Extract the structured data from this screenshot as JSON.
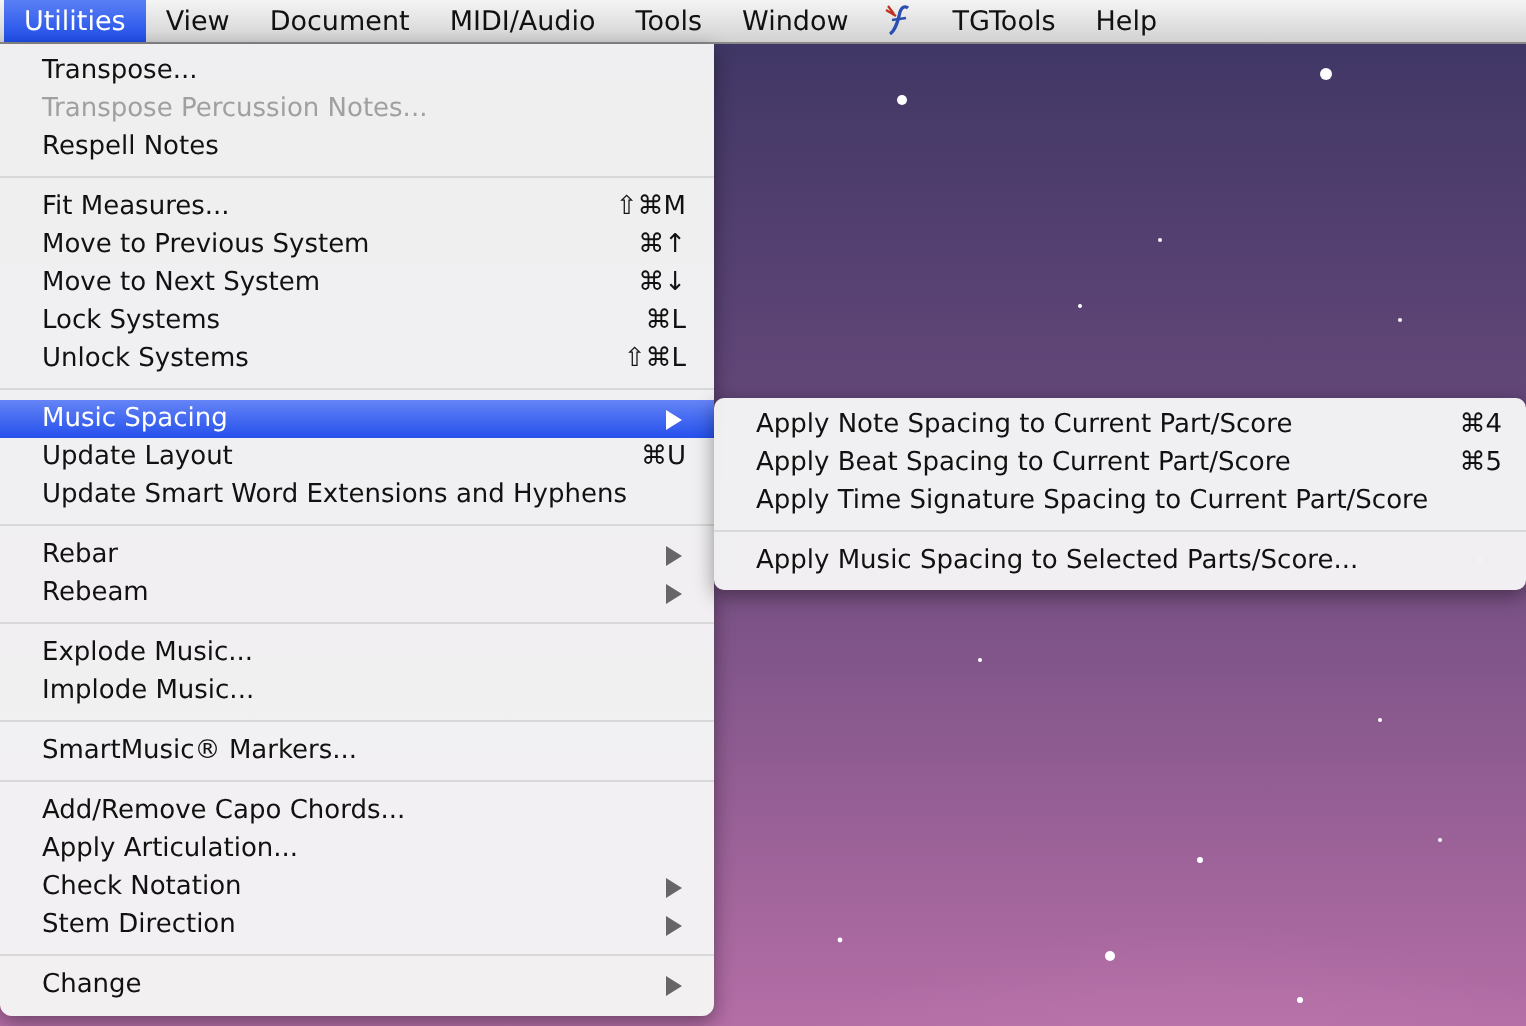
{
  "menu_bar": [
    {
      "kind": "text",
      "label": "Utilities",
      "selected": true
    },
    {
      "kind": "text",
      "label": "View",
      "selected": false
    },
    {
      "kind": "text",
      "label": "Document",
      "selected": false
    },
    {
      "kind": "text",
      "label": "MIDI/Audio",
      "selected": false
    },
    {
      "kind": "text",
      "label": "Tools",
      "selected": false
    },
    {
      "kind": "text",
      "label": "Window",
      "selected": false
    },
    {
      "kind": "icon",
      "selected": false
    },
    {
      "kind": "text",
      "label": "TGTools",
      "selected": false
    },
    {
      "kind": "text",
      "label": "Help",
      "selected": false
    }
  ],
  "menu": [
    {
      "kind": "item",
      "label": "Transpose...",
      "disabled": false,
      "selected": false
    },
    {
      "kind": "item",
      "label": "Transpose Percussion Notes...",
      "disabled": true,
      "selected": false
    },
    {
      "kind": "item",
      "label": "Respell Notes",
      "disabled": false,
      "selected": false
    },
    {
      "kind": "separator"
    },
    {
      "kind": "item",
      "label": "Fit Measures...",
      "shortcut": "⇧⌘M",
      "disabled": false,
      "selected": false
    },
    {
      "kind": "item",
      "label": "Move to Previous System",
      "shortcut": "⌘↑",
      "disabled": false,
      "selected": false
    },
    {
      "kind": "item",
      "label": "Move to Next System",
      "shortcut": "⌘↓",
      "disabled": false,
      "selected": false
    },
    {
      "kind": "item",
      "label": "Lock Systems",
      "shortcut": "⌘L",
      "disabled": false,
      "selected": false
    },
    {
      "kind": "item",
      "label": "Unlock Systems",
      "shortcut": "⇧⌘L",
      "disabled": false,
      "selected": false
    },
    {
      "kind": "separator"
    },
    {
      "kind": "item",
      "label": "Music Spacing",
      "submenu": true,
      "disabled": false,
      "selected": true
    },
    {
      "kind": "item",
      "label": "Update Layout",
      "shortcut": "⌘U",
      "disabled": false,
      "selected": false
    },
    {
      "kind": "item",
      "label": "Update Smart Word Extensions and Hyphens",
      "disabled": false,
      "selected": false
    },
    {
      "kind": "separator"
    },
    {
      "kind": "item",
      "label": "Rebar",
      "submenu": true,
      "disabled": false,
      "selected": false
    },
    {
      "kind": "item",
      "label": "Rebeam",
      "submenu": true,
      "disabled": false,
      "selected": false
    },
    {
      "kind": "separator"
    },
    {
      "kind": "item",
      "label": "Explode Music...",
      "disabled": false,
      "selected": false
    },
    {
      "kind": "item",
      "label": "Implode Music...",
      "disabled": false,
      "selected": false
    },
    {
      "kind": "separator"
    },
    {
      "kind": "item",
      "label": "SmartMusic® Markers...",
      "disabled": false,
      "selected": false
    },
    {
      "kind": "separator"
    },
    {
      "kind": "item",
      "label": "Add/Remove Capo Chords...",
      "disabled": false,
      "selected": false
    },
    {
      "kind": "item",
      "label": "Apply Articulation...",
      "disabled": false,
      "selected": false
    },
    {
      "kind": "item",
      "label": "Check Notation",
      "submenu": true,
      "disabled": false,
      "selected": false
    },
    {
      "kind": "item",
      "label": "Stem Direction",
      "submenu": true,
      "disabled": false,
      "selected": false
    },
    {
      "kind": "separator"
    },
    {
      "kind": "item",
      "label": "Change",
      "submenu": true,
      "disabled": false,
      "selected": false
    }
  ],
  "submenu": [
    {
      "kind": "item",
      "label": "Apply Note Spacing to Current Part/Score",
      "shortcut": "⌘4",
      "disabled": false,
      "selected": false
    },
    {
      "kind": "item",
      "label": "Apply Beat Spacing to Current Part/Score",
      "shortcut": "⌘5",
      "disabled": false,
      "selected": false
    },
    {
      "kind": "item",
      "label": "Apply Time Signature Spacing to Current Part/Score",
      "disabled": false,
      "selected": false
    },
    {
      "kind": "separator"
    },
    {
      "kind": "item",
      "label": "Apply Music Spacing to Selected Parts/Score...",
      "disabled": false,
      "selected": false
    }
  ]
}
